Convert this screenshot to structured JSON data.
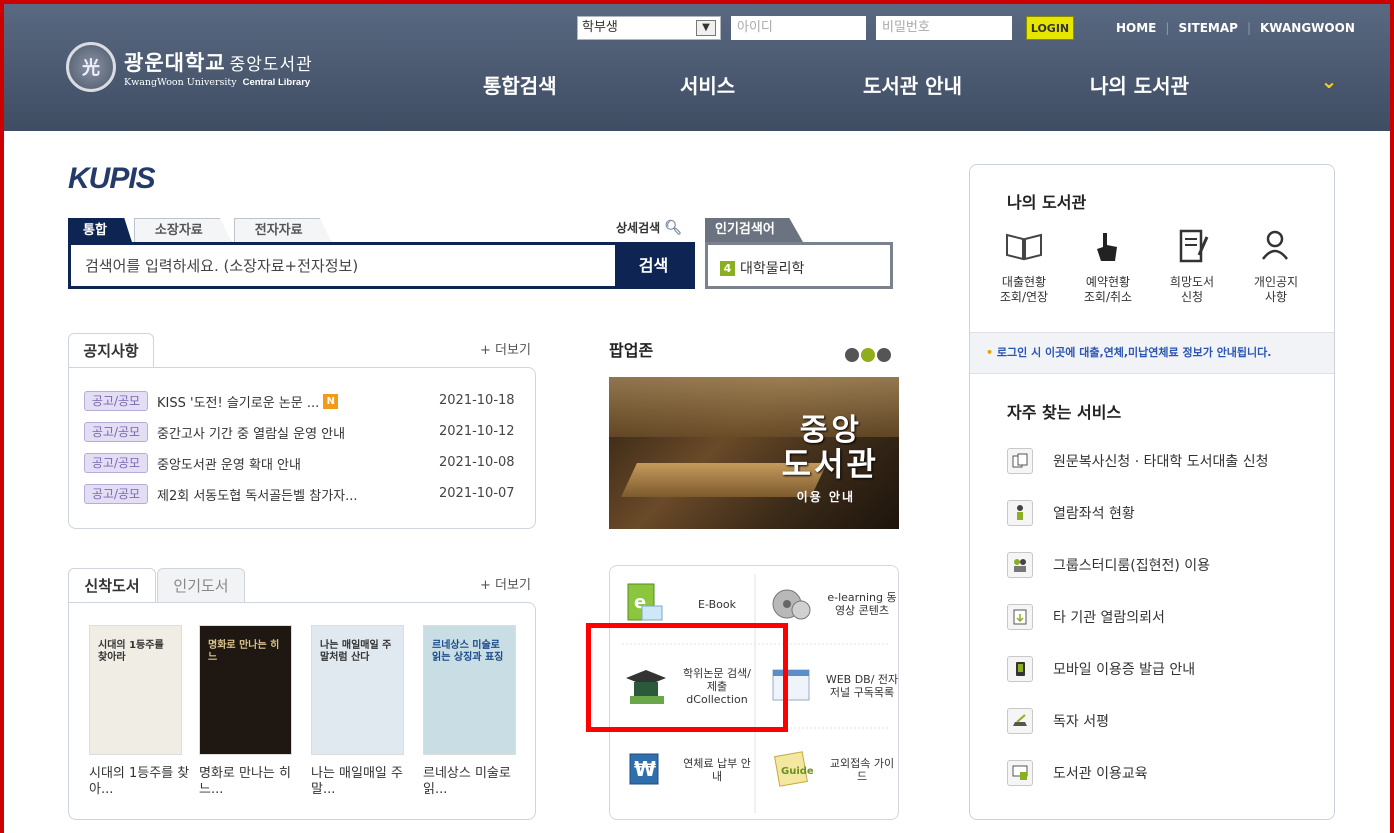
{
  "header": {
    "logo_seal": "光",
    "logo_name": "광운대학교",
    "logo_sub": "중앙도서관",
    "logo_en": "KwangWoon University",
    "logo_en2": "Central Library",
    "user_type": "학부생",
    "id_placeholder": "아이디",
    "pw_placeholder": "비밀번호",
    "login_label": "LOGIN",
    "top_links": [
      "HOME",
      "SITEMAP",
      "KWANGWOON"
    ],
    "nav": [
      "통합검색",
      "서비스",
      "도서관 안내",
      "나의 도서관"
    ],
    "nav_more_icon": "chevron-down-icon"
  },
  "search": {
    "title": "KUPIS",
    "tabs": [
      "통합",
      "소장자료",
      "전자자료"
    ],
    "detail_label": "상세검색",
    "placeholder": "검색어를 입력하세요. (소장자료+전자정보)",
    "button": "검색",
    "popular_tab": "인기검색어",
    "popular_rank": "4",
    "popular_term": "대학물리학"
  },
  "notice": {
    "tab": "공지사항",
    "more": "+ 더보기",
    "items": [
      {
        "badge": "공고/공모",
        "title": "KISS '도전! 슬기로운 논문 ...",
        "new": "N",
        "date": "2021-10-18"
      },
      {
        "badge": "공고/공모",
        "title": "중간고사 기간 중 열람실 운영 안내",
        "new": "",
        "date": "2021-10-12"
      },
      {
        "badge": "공고/공모",
        "title": "중앙도서관 운영 확대 안내",
        "new": "",
        "date": "2021-10-08"
      },
      {
        "badge": "공고/공모",
        "title": "제2회 서동도협 독서골든벨 참가자...",
        "new": "",
        "date": "2021-10-07"
      }
    ]
  },
  "books": {
    "tabs": [
      "신착도서",
      "인기도서"
    ],
    "more": "+ 더보기",
    "items": [
      {
        "caption": "시대의 1등주를 찾아...",
        "cover_text": "시대의 1등주를 찾아라",
        "bg": "#f0ede4",
        "fg": "#333"
      },
      {
        "caption": "명화로 만나는 히느...",
        "cover_text": "명화로 만나는 히느",
        "bg": "#1e1712",
        "fg": "#d8c28a"
      },
      {
        "caption": "나는 매일매일 주말...",
        "cover_text": "나는 매일매일 주말처럼 산다",
        "bg": "#dfe9ef",
        "fg": "#333"
      },
      {
        "caption": "르네상스 미술로 읽...",
        "cover_text": "르네상스 미술로 읽는 상징과 표징",
        "bg": "#c9dde4",
        "fg": "#1a4a8a"
      }
    ]
  },
  "popup": {
    "title": "팝업존",
    "banner_line1": "중앙",
    "banner_line2": "도서관",
    "banner_line3": "이용 안내",
    "dot_colors": [
      "#555555",
      "#8fae1b",
      "#555555"
    ]
  },
  "services": [
    {
      "label": "E-Book",
      "icon": "ebook-icon"
    },
    {
      "label": "e-learning 동영상 콘텐츠",
      "icon": "film-reel-icon"
    },
    {
      "label": "학위논문 검색/제출 dCollection",
      "icon": "graduation-cap-icon"
    },
    {
      "label": "WEB DB/ 전자저널 구독목록",
      "icon": "browser-window-icon"
    },
    {
      "label": "연체료 납부 안내",
      "icon": "won-bill-icon"
    },
    {
      "label": "교외접속 가이드",
      "icon": "guide-book-icon"
    }
  ],
  "mylib": {
    "title": "나의 도서관",
    "items": [
      {
        "label1": "대출현황",
        "label2": "조회/연장",
        "icon": "open-book-icon"
      },
      {
        "label1": "예약현황",
        "label2": "조회/취소",
        "icon": "pointer-hand-icon"
      },
      {
        "label1": "희망도서",
        "label2": "신청",
        "icon": "note-pen-icon"
      },
      {
        "label1": "개인공지",
        "label2": "사항",
        "icon": "person-icon"
      }
    ],
    "login_info": "로그인 시 이곳에 대출,연체,미납연체료 정보가 안내됩니다."
  },
  "favorites": {
    "title": "자주 찾는 서비스",
    "items": [
      {
        "label": "원문복사신청 · 타대학 도서대출 신청",
        "icon": "copy-docs-icon"
      },
      {
        "label": "열람좌석 현황",
        "icon": "seat-icon"
      },
      {
        "label": "그룹스터디룸(집현전) 이용",
        "icon": "group-icon"
      },
      {
        "label": "타 기관 열람의뢰서",
        "icon": "document-download-icon"
      },
      {
        "label": "모바일 이용증 발급 안내",
        "icon": "mobile-icon"
      },
      {
        "label": "독자 서평",
        "icon": "writing-icon"
      },
      {
        "label": "도서관 이용교육",
        "icon": "presentation-icon"
      }
    ]
  }
}
